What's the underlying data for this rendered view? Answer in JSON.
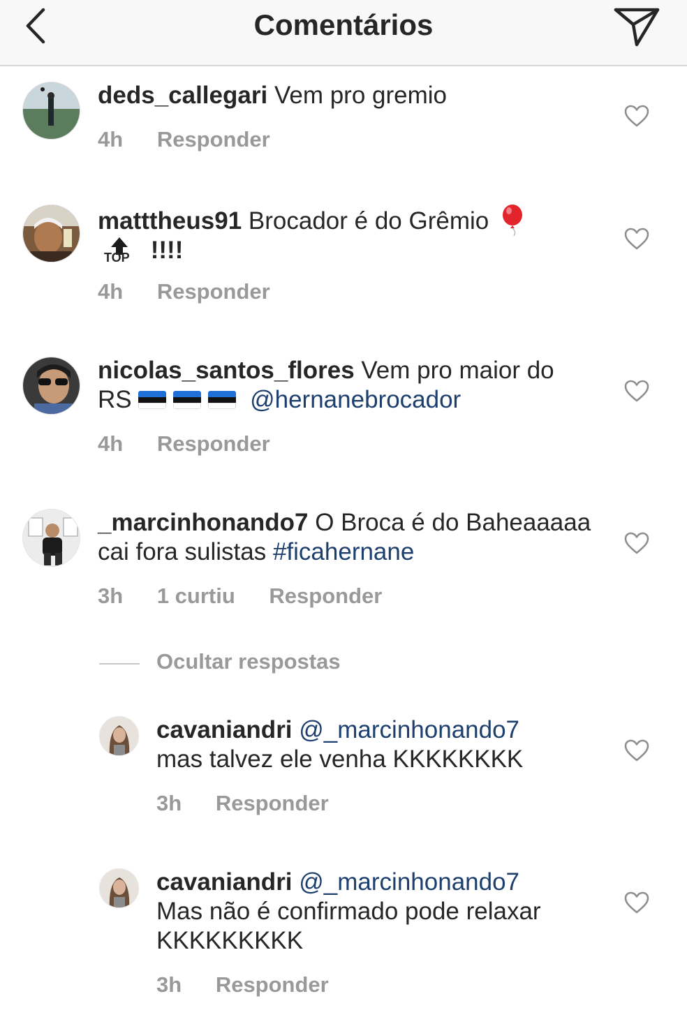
{
  "header": {
    "title": "Comentários",
    "back_icon": "chevron-left-icon",
    "send_icon": "paper-plane-icon"
  },
  "comments": [
    {
      "username": "deds_callegari",
      "text": "Vem pro gremio",
      "time": "4h",
      "reply_label": "Responder"
    },
    {
      "username": "matttheus91",
      "text": "Brocador é do Grêmio",
      "text_suffix": "!!!!",
      "emojis": [
        "balloon-emoji",
        "top-arrow-emoji"
      ],
      "top_label": "TOP",
      "time": "4h",
      "reply_label": "Responder"
    },
    {
      "username": "nicolas_santos_flores",
      "text": "Vem pro maior do RS",
      "mention": "@hernanebrocador",
      "emojis": [
        "estonia-flag-emoji",
        "estonia-flag-emoji",
        "estonia-flag-emoji"
      ],
      "time": "4h",
      "reply_label": "Responder"
    },
    {
      "username": "_marcinhonando7",
      "text": "O Broca é do Baheaaaaa cai fora sulistas",
      "hashtag": "#ficahernane",
      "time": "3h",
      "likes": "1 curtiu",
      "reply_label": "Responder"
    }
  ],
  "hide_replies_label": "Ocultar respostas",
  "replies": [
    {
      "username": "cavaniandri",
      "mention": "@_marcinhonando7",
      "text": "mas talvez ele venha KKKKKKKK",
      "time": "3h",
      "reply_label": "Responder"
    },
    {
      "username": "cavaniandri",
      "mention": "@_marcinhonando7",
      "text": "Mas não é confirmado pode relaxar KKKKKKKKK",
      "time": "3h",
      "reply_label": "Responder"
    }
  ],
  "colors": {
    "link_blue": "#1d3f6e",
    "meta_gray": "#999999",
    "text": "#262626"
  }
}
